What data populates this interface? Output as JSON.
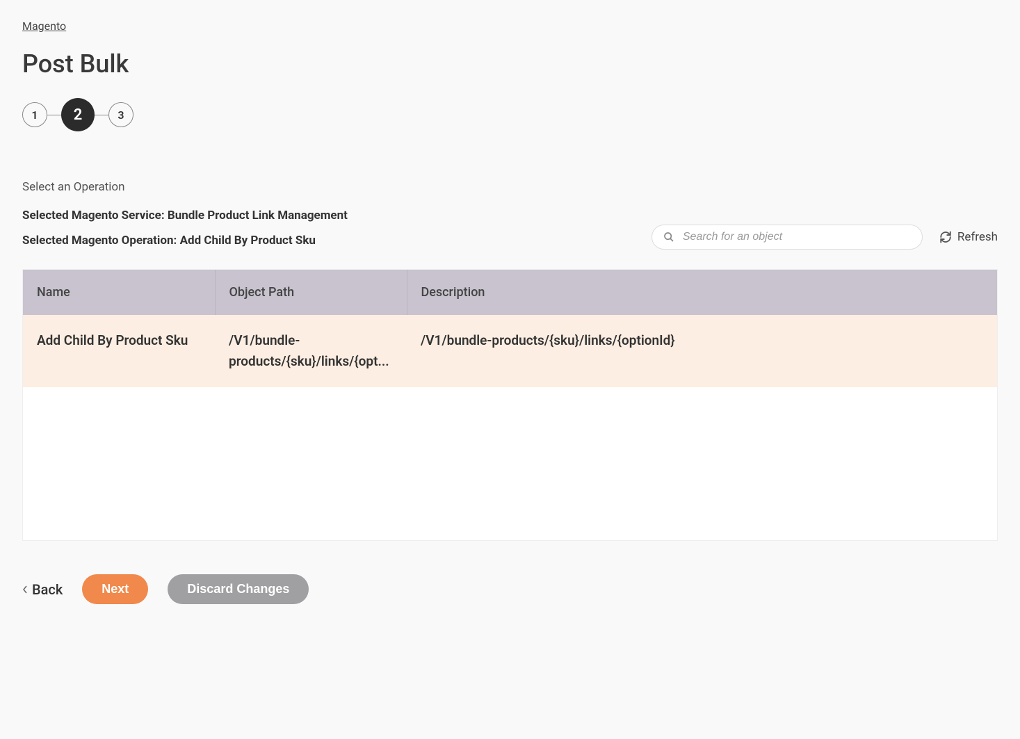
{
  "breadcrumb": "Magento",
  "title": "Post Bulk",
  "stepper": {
    "steps": [
      "1",
      "2",
      "3"
    ],
    "active": 1
  },
  "section_label": "Select an Operation",
  "selected_service_label": "Selected Magento Service: Bundle Product Link Management",
  "selected_operation_label": "Selected Magento Operation: Add Child By Product Sku",
  "search": {
    "placeholder": "Search for an object"
  },
  "refresh_label": "Refresh",
  "table": {
    "headers": {
      "name": "Name",
      "path": "Object Path",
      "description": "Description"
    },
    "rows": [
      {
        "name": "Add Child By Product Sku",
        "path": "/V1/bundle-products/{sku}/links/{opt...",
        "description": "/V1/bundle-products/{sku}/links/{optionId}"
      }
    ]
  },
  "footer": {
    "back": "Back",
    "next": "Next",
    "discard": "Discard Changes"
  }
}
